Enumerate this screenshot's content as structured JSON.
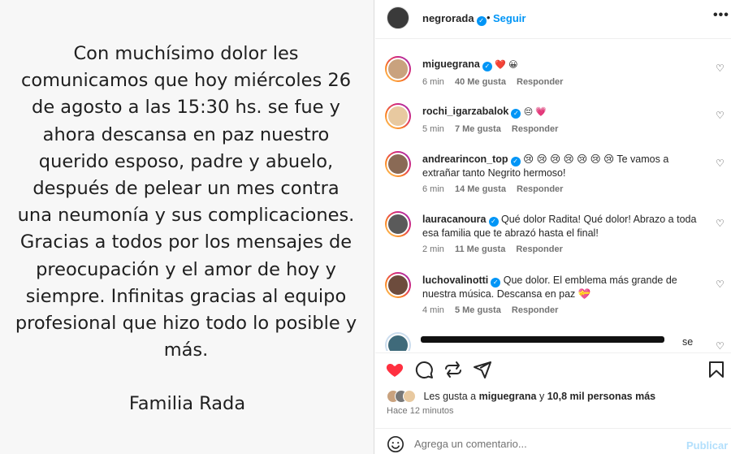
{
  "post_image": {
    "message": "Con muchísimo dolor les comunicamos que hoy miércoles 26 de agosto a las 15:30 hs. se fue y ahora descansa en paz nuestro querido esposo, padre y abuelo, después de pelear un mes contra una neumonía y sus complicaciones. Gracias a todos por los mensajes de preocupación y el amor de hoy y siempre. Infinitas gracias al equipo profesional que hizo todo lo posible y más.",
    "signature": "Familia Rada"
  },
  "header": {
    "username": "negrorada",
    "dot": "•",
    "follow_label": "Seguir",
    "more_label": "•••"
  },
  "comments": [
    {
      "username": "miguegrana",
      "text": "❤️ 😀",
      "time": "6 min",
      "likes": "40 Me gusta",
      "reply": "Responder"
    },
    {
      "username": "rochi_igarzabalok",
      "text": "😔 💗",
      "time": "5 min",
      "likes": "7 Me gusta",
      "reply": "Responder"
    },
    {
      "username": "andrearincon_top",
      "text": "😢 😢 😢 😢 😢 😢 😢 Te vamos a extrañar tanto Negrito hermoso!",
      "time": "6 min",
      "likes": "14 Me gusta",
      "reply": "Responder"
    },
    {
      "username": "lauracanoura",
      "text": "Qué dolor Radita! Qué dolor! Abrazo a toda esa familia que te abrazó hasta el final!",
      "time": "2 min",
      "likes": "11 Me gusta",
      "reply": "Responder"
    },
    {
      "username": "luchovalinotti",
      "text": "Que dolor. El emblema más grande de nuestra música. Descansa en paz 💝",
      "time": "4 min",
      "likes": "5 Me gusta",
      "reply": "Responder"
    },
    {
      "username": "",
      "text": "se",
      "time": "",
      "likes": "",
      "reply": ""
    }
  ],
  "likes": {
    "prefix": "Les gusta a",
    "user": "miguegrana",
    "middle": "y",
    "count": "10,8 mil personas más"
  },
  "time_ago": "Hace 12 minutos",
  "add_comment": {
    "placeholder": "Agrega un comentario...",
    "publish_label": "Publicar"
  },
  "colors": {
    "accent": "#0095f6",
    "like_red": "#ff3040",
    "publish_disabled": "#b2dffc"
  },
  "icons": [
    "verified-icon",
    "heart-icon",
    "comment-icon",
    "share-icon",
    "save-icon",
    "smile-icon",
    "more-icon"
  ]
}
